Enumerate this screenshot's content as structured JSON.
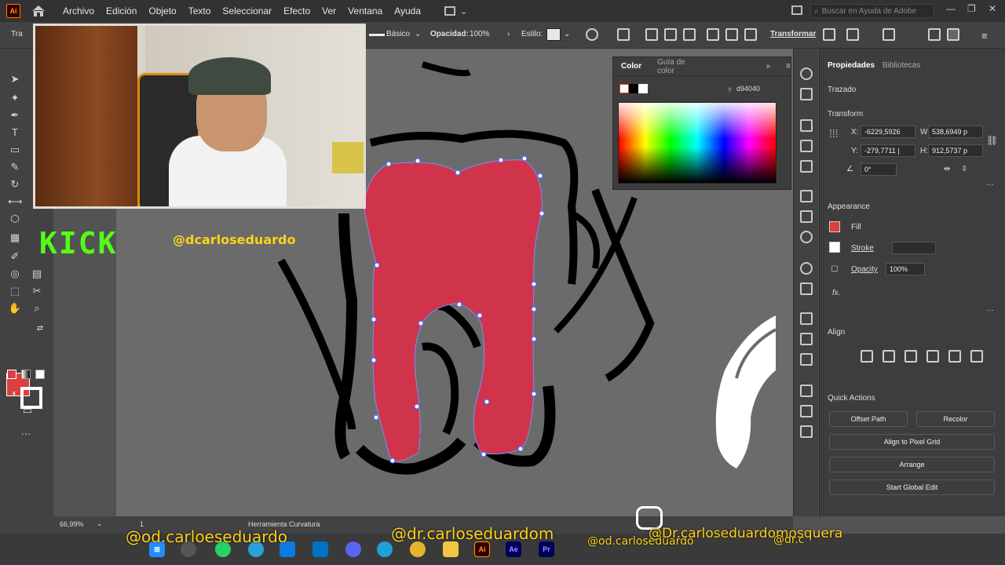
{
  "menubar": {
    "logo": "Ai",
    "items": [
      "Archivo",
      "Edición",
      "Objeto",
      "Texto",
      "Seleccionar",
      "Efecto",
      "Ver",
      "Ventana",
      "Ayuda"
    ],
    "help_placeholder": "Buscar en Ayuda de Adobe"
  },
  "control_bar": {
    "left_label": "Tra",
    "stroke_profile": "Básico",
    "opacity_label": "Opacidad:",
    "opacity_value": "100%",
    "style_label": "Estilo:",
    "transform_label": "Transformar"
  },
  "overlay": {
    "kick_text": "KICK",
    "kick_user": "@dcarloseduardo",
    "handle_1": "@od.carloeseduardo",
    "handle_2": "@dr.carloseduardom",
    "handle_3": "@od.carloseduardo",
    "handle_4": "@Dr.carloseduardomosquera",
    "handle_5": "@dr.c"
  },
  "color_panel": {
    "tab_color": "Color",
    "tab_guide": "Guía de color",
    "hex_value": "d94040",
    "fill_color": "#d94040"
  },
  "properties": {
    "tab_properties": "Propiedades",
    "tab_libraries": "Bibliotecas",
    "object_type": "Trazado",
    "transform_title": "Transform",
    "x_label": "X:",
    "x_value": "-6229,5926",
    "y_label": "Y:",
    "y_value": "-279,7711 |",
    "w_label": "W:",
    "w_value": "538,6949 p",
    "h_label": "H:",
    "h_value": "912,5737 p",
    "angle_value": "0°",
    "appearance_title": "Appearance",
    "fill_label": "Fill",
    "stroke_label": "Stroke",
    "opacity_label": "Opacity",
    "opacity_value": "100%",
    "fx_label": "fx.",
    "align_title": "Align",
    "quick_actions_title": "Quick Actions",
    "offset_path": "Offset Path",
    "recolor": "Recolor",
    "align_pixel_grid": "Align to Pixel Grid",
    "arrange": "Arrange",
    "start_global_edit": "Start Global Edit"
  },
  "status": {
    "zoom": "66,99%",
    "artboard_num": "1",
    "tool_name": "Herramienta Curvatura"
  },
  "taskbar": {
    "apps": [
      "Ai",
      "Ae",
      "Pr"
    ]
  }
}
